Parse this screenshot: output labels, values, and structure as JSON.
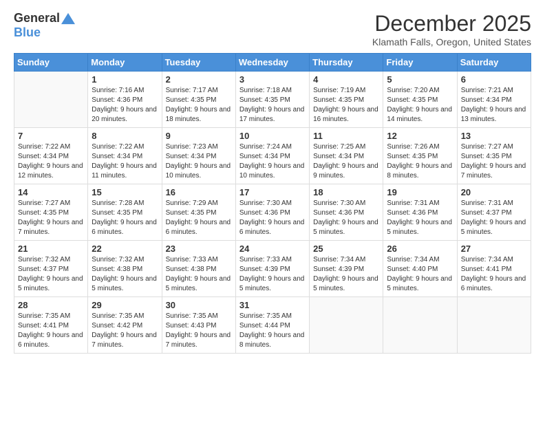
{
  "logo": {
    "general": "General",
    "blue": "Blue"
  },
  "title": "December 2025",
  "location": "Klamath Falls, Oregon, United States",
  "header_days": [
    "Sunday",
    "Monday",
    "Tuesday",
    "Wednesday",
    "Thursday",
    "Friday",
    "Saturday"
  ],
  "weeks": [
    [
      {
        "num": "",
        "sunrise": "",
        "sunset": "",
        "daylight": ""
      },
      {
        "num": "1",
        "sunrise": "Sunrise: 7:16 AM",
        "sunset": "Sunset: 4:36 PM",
        "daylight": "Daylight: 9 hours and 20 minutes."
      },
      {
        "num": "2",
        "sunrise": "Sunrise: 7:17 AM",
        "sunset": "Sunset: 4:35 PM",
        "daylight": "Daylight: 9 hours and 18 minutes."
      },
      {
        "num": "3",
        "sunrise": "Sunrise: 7:18 AM",
        "sunset": "Sunset: 4:35 PM",
        "daylight": "Daylight: 9 hours and 17 minutes."
      },
      {
        "num": "4",
        "sunrise": "Sunrise: 7:19 AM",
        "sunset": "Sunset: 4:35 PM",
        "daylight": "Daylight: 9 hours and 16 minutes."
      },
      {
        "num": "5",
        "sunrise": "Sunrise: 7:20 AM",
        "sunset": "Sunset: 4:35 PM",
        "daylight": "Daylight: 9 hours and 14 minutes."
      },
      {
        "num": "6",
        "sunrise": "Sunrise: 7:21 AM",
        "sunset": "Sunset: 4:34 PM",
        "daylight": "Daylight: 9 hours and 13 minutes."
      }
    ],
    [
      {
        "num": "7",
        "sunrise": "Sunrise: 7:22 AM",
        "sunset": "Sunset: 4:34 PM",
        "daylight": "Daylight: 9 hours and 12 minutes."
      },
      {
        "num": "8",
        "sunrise": "Sunrise: 7:22 AM",
        "sunset": "Sunset: 4:34 PM",
        "daylight": "Daylight: 9 hours and 11 minutes."
      },
      {
        "num": "9",
        "sunrise": "Sunrise: 7:23 AM",
        "sunset": "Sunset: 4:34 PM",
        "daylight": "Daylight: 9 hours and 10 minutes."
      },
      {
        "num": "10",
        "sunrise": "Sunrise: 7:24 AM",
        "sunset": "Sunset: 4:34 PM",
        "daylight": "Daylight: 9 hours and 10 minutes."
      },
      {
        "num": "11",
        "sunrise": "Sunrise: 7:25 AM",
        "sunset": "Sunset: 4:34 PM",
        "daylight": "Daylight: 9 hours and 9 minutes."
      },
      {
        "num": "12",
        "sunrise": "Sunrise: 7:26 AM",
        "sunset": "Sunset: 4:35 PM",
        "daylight": "Daylight: 9 hours and 8 minutes."
      },
      {
        "num": "13",
        "sunrise": "Sunrise: 7:27 AM",
        "sunset": "Sunset: 4:35 PM",
        "daylight": "Daylight: 9 hours and 7 minutes."
      }
    ],
    [
      {
        "num": "14",
        "sunrise": "Sunrise: 7:27 AM",
        "sunset": "Sunset: 4:35 PM",
        "daylight": "Daylight: 9 hours and 7 minutes."
      },
      {
        "num": "15",
        "sunrise": "Sunrise: 7:28 AM",
        "sunset": "Sunset: 4:35 PM",
        "daylight": "Daylight: 9 hours and 6 minutes."
      },
      {
        "num": "16",
        "sunrise": "Sunrise: 7:29 AM",
        "sunset": "Sunset: 4:35 PM",
        "daylight": "Daylight: 9 hours and 6 minutes."
      },
      {
        "num": "17",
        "sunrise": "Sunrise: 7:30 AM",
        "sunset": "Sunset: 4:36 PM",
        "daylight": "Daylight: 9 hours and 6 minutes."
      },
      {
        "num": "18",
        "sunrise": "Sunrise: 7:30 AM",
        "sunset": "Sunset: 4:36 PM",
        "daylight": "Daylight: 9 hours and 5 minutes."
      },
      {
        "num": "19",
        "sunrise": "Sunrise: 7:31 AM",
        "sunset": "Sunset: 4:36 PM",
        "daylight": "Daylight: 9 hours and 5 minutes."
      },
      {
        "num": "20",
        "sunrise": "Sunrise: 7:31 AM",
        "sunset": "Sunset: 4:37 PM",
        "daylight": "Daylight: 9 hours and 5 minutes."
      }
    ],
    [
      {
        "num": "21",
        "sunrise": "Sunrise: 7:32 AM",
        "sunset": "Sunset: 4:37 PM",
        "daylight": "Daylight: 9 hours and 5 minutes."
      },
      {
        "num": "22",
        "sunrise": "Sunrise: 7:32 AM",
        "sunset": "Sunset: 4:38 PM",
        "daylight": "Daylight: 9 hours and 5 minutes."
      },
      {
        "num": "23",
        "sunrise": "Sunrise: 7:33 AM",
        "sunset": "Sunset: 4:38 PM",
        "daylight": "Daylight: 9 hours and 5 minutes."
      },
      {
        "num": "24",
        "sunrise": "Sunrise: 7:33 AM",
        "sunset": "Sunset: 4:39 PM",
        "daylight": "Daylight: 9 hours and 5 minutes."
      },
      {
        "num": "25",
        "sunrise": "Sunrise: 7:34 AM",
        "sunset": "Sunset: 4:39 PM",
        "daylight": "Daylight: 9 hours and 5 minutes."
      },
      {
        "num": "26",
        "sunrise": "Sunrise: 7:34 AM",
        "sunset": "Sunset: 4:40 PM",
        "daylight": "Daylight: 9 hours and 5 minutes."
      },
      {
        "num": "27",
        "sunrise": "Sunrise: 7:34 AM",
        "sunset": "Sunset: 4:41 PM",
        "daylight": "Daylight: 9 hours and 6 minutes."
      }
    ],
    [
      {
        "num": "28",
        "sunrise": "Sunrise: 7:35 AM",
        "sunset": "Sunset: 4:41 PM",
        "daylight": "Daylight: 9 hours and 6 minutes."
      },
      {
        "num": "29",
        "sunrise": "Sunrise: 7:35 AM",
        "sunset": "Sunset: 4:42 PM",
        "daylight": "Daylight: 9 hours and 7 minutes."
      },
      {
        "num": "30",
        "sunrise": "Sunrise: 7:35 AM",
        "sunset": "Sunset: 4:43 PM",
        "daylight": "Daylight: 9 hours and 7 minutes."
      },
      {
        "num": "31",
        "sunrise": "Sunrise: 7:35 AM",
        "sunset": "Sunset: 4:44 PM",
        "daylight": "Daylight: 9 hours and 8 minutes."
      },
      {
        "num": "",
        "sunrise": "",
        "sunset": "",
        "daylight": ""
      },
      {
        "num": "",
        "sunrise": "",
        "sunset": "",
        "daylight": ""
      },
      {
        "num": "",
        "sunrise": "",
        "sunset": "",
        "daylight": ""
      }
    ]
  ]
}
